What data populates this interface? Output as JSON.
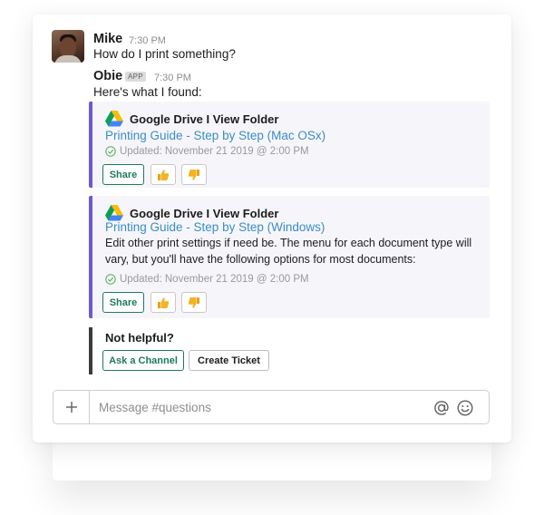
{
  "messages": [
    {
      "author": "Mike",
      "time": "7:30 PM",
      "text": "How do I print something?"
    },
    {
      "author": "Obie",
      "badge": "APP",
      "time": "7:30 PM",
      "text": "Here's what I found:"
    }
  ],
  "attachments": [
    {
      "source": "Google Drive I View Folder",
      "link": "Printing Guide - Step by Step (Mac OSx)",
      "updated": "Updated: November 21 2019 @ 2:00 PM",
      "share_label": "Share"
    },
    {
      "source": "Google Drive I View Folder",
      "link": "Printing Guide - Step by Step (Windows)",
      "description": "Edit other print settings if need be. The menu for each document type will vary, but you'll have the following options for most documents:",
      "updated": "Updated: November 21 2019 @ 2:00 PM",
      "share_label": "Share"
    }
  ],
  "not_helpful": {
    "title": "Not helpful?",
    "ask_label": "Ask a Channel",
    "ticket_label": "Create Ticket"
  },
  "composer": {
    "placeholder": "Message #questions"
  },
  "icons": {
    "drive": "google-drive-icon",
    "check": "check-circle-icon",
    "thumbs_up": "thumbs-up-icon",
    "thumbs_down": "thumbs-down-icon",
    "plus": "plus-icon",
    "mention": "at-mention-icon",
    "emoji": "emoji-icon"
  },
  "colors": {
    "accent_bar": "#6e5ad6",
    "link": "#3a8dc5",
    "green": "#1e7a5c",
    "thumb_yellow": "#f2b324"
  }
}
